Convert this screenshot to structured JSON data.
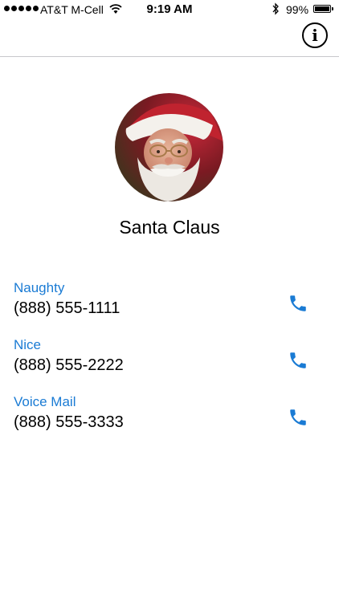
{
  "status_bar": {
    "carrier": "AT&T M-Cell",
    "time": "9:19 AM",
    "battery_percent": "99%",
    "battery_level": 0.99,
    "signal_bars": 5
  },
  "nav_bar": {
    "info_icon": "info-icon",
    "info_glyph": "i"
  },
  "contact": {
    "name": "Santa Claus",
    "avatar": "santa-photo",
    "phones": [
      {
        "label": "Naughty",
        "number": "(888) 555-1111",
        "icon": "phone-icon"
      },
      {
        "label": "Nice",
        "number": "(888) 555-2222",
        "icon": "phone-icon"
      },
      {
        "label": "Voice Mail",
        "number": "(888) 555-3333",
        "icon": "phone-icon"
      }
    ]
  },
  "colors": {
    "accent": "#1a7bd4",
    "divider": "#c8c7cc"
  }
}
